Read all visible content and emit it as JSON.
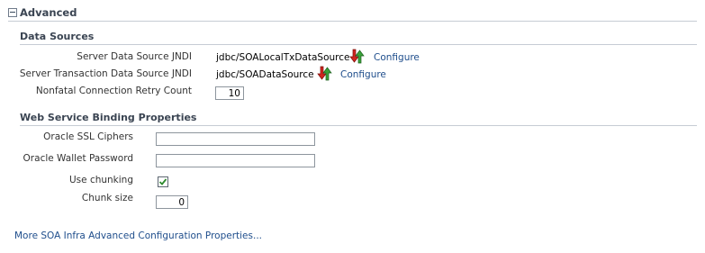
{
  "section": {
    "title": "Advanced"
  },
  "data_sources": {
    "title": "Data Sources",
    "server_jndi": {
      "label": "Server Data Source JNDI",
      "value": "jdbc/SOALocalTxDataSource",
      "link": "Configure"
    },
    "tx_jndi": {
      "label": "Server Transaction Data Source JNDI",
      "value": "jdbc/SOADataSource",
      "link": "Configure"
    },
    "retry": {
      "label": "Nonfatal Connection Retry Count",
      "value": "10"
    }
  },
  "ws_binding": {
    "title": "Web Service Binding Properties",
    "ssl_ciphers": {
      "label": "Oracle SSL Ciphers",
      "value": ""
    },
    "wallet_password": {
      "label": "Oracle Wallet Password",
      "value": ""
    },
    "chunking": {
      "label": "Use chunking",
      "checked": true
    },
    "chunk_size": {
      "label": "Chunk size",
      "value": "0"
    }
  },
  "footer": {
    "more_link": "More SOA Infra Advanced Configuration Properties..."
  },
  "colors": {
    "link": "#1f4e8c",
    "rule": "#c6ccd4",
    "check": "#2e8b2e"
  },
  "icons": {
    "test_connection": "test-connection-icon",
    "collapse": "collapse-icon",
    "check": "checkmark-icon"
  }
}
